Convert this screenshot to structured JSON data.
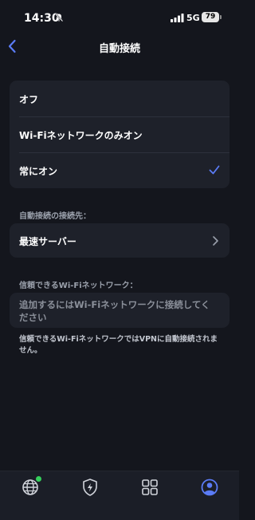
{
  "status_bar": {
    "time": "14:30",
    "network": "5G",
    "battery": "79"
  },
  "header": {
    "title": "自動接続"
  },
  "options": [
    {
      "label": "オフ",
      "selected": false
    },
    {
      "label": "Wi-Fiネットワークのみオン",
      "selected": false
    },
    {
      "label": "常にオン",
      "selected": true
    }
  ],
  "destination": {
    "section_label": "自動接続の接続先：",
    "value": "最速サーバー"
  },
  "trusted_wifi": {
    "section_label": "信頼できるWi-Fiネットワーク：",
    "placeholder": "追加するにはWi-Fiネットワークに接続してください",
    "footnote": "信頼できるWi-FiネットワークではVPNに自動接続されません。"
  },
  "tab_bar": {
    "items": [
      "globe-icon",
      "shield-bolt-icon",
      "grid-icon",
      "profile-icon"
    ],
    "active_index": 3,
    "accent": "#5b7cf6"
  },
  "colors": {
    "background": "#14161d",
    "card": "#1e212a",
    "accent": "#5b7cf6",
    "online_dot": "#35d05c"
  }
}
